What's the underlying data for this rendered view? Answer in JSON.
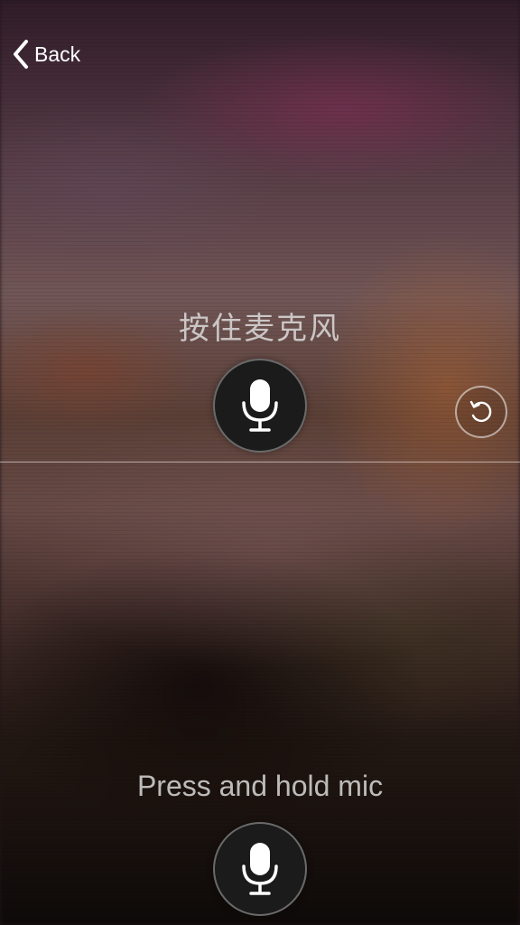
{
  "nav": {
    "back_label": "Back",
    "back_icon": "chevron-left-icon"
  },
  "upper_panel": {
    "prompt": "按住麦克风",
    "mic_icon": "microphone-icon"
  },
  "lower_panel": {
    "prompt": "Press and hold mic",
    "mic_icon": "microphone-icon"
  },
  "controls": {
    "swap_icon": "rotate-icon"
  },
  "colors": {
    "mic_button_bg": "#1b1b1b",
    "text": "#e1e1e1",
    "icon": "#ffffff"
  }
}
